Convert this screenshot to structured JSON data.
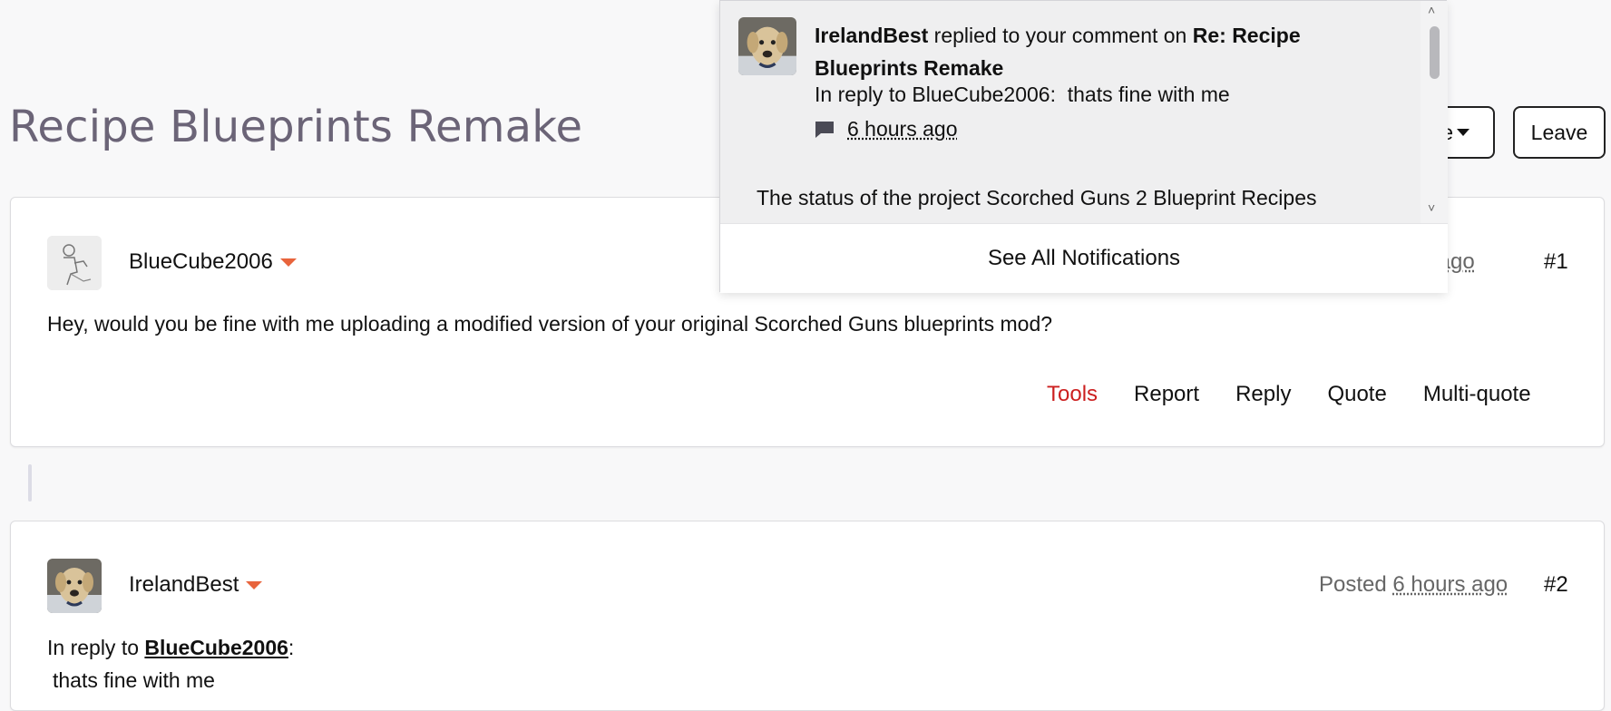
{
  "page": {
    "title": "Recipe Blueprints Remake"
  },
  "header_buttons": {
    "partial_label": "e",
    "leave_label": "Leave"
  },
  "posts": [
    {
      "author": "BlueCube2006",
      "posted_partial": "rs ago",
      "number": "#1",
      "body": "Hey, would you be fine with me uploading a modified version of your original Scorched Guns blueprints mod?",
      "actions": {
        "tools": "Tools",
        "report": "Report",
        "reply": "Reply",
        "quote": "Quote",
        "multiquote": "Multi-quote"
      }
    },
    {
      "author": "IrelandBest",
      "posted_prefix": "Posted",
      "posted_time": "6 hours ago",
      "number": "#2",
      "reply_prefix": "In reply to",
      "reply_user": "BlueCube2006",
      "reply_suffix": ":",
      "body": "thats fine with me"
    }
  ],
  "notifications": {
    "items": [
      {
        "user": "IrelandBest",
        "action": "replied to your comment on",
        "target": "Re: Recipe Blueprints Remake",
        "preview": "In reply to BlueCube2006:  thats fine with me",
        "time": "6 hours ago",
        "icon": "comment-icon"
      }
    ],
    "next_item_text": "The status of the project Scorched Guns 2 Blueprint Recipes",
    "see_all_label": "See All Notifications"
  },
  "colors": {
    "title": "#6b6477",
    "accent": "#e8643c",
    "tools": "#cc1f1f"
  }
}
